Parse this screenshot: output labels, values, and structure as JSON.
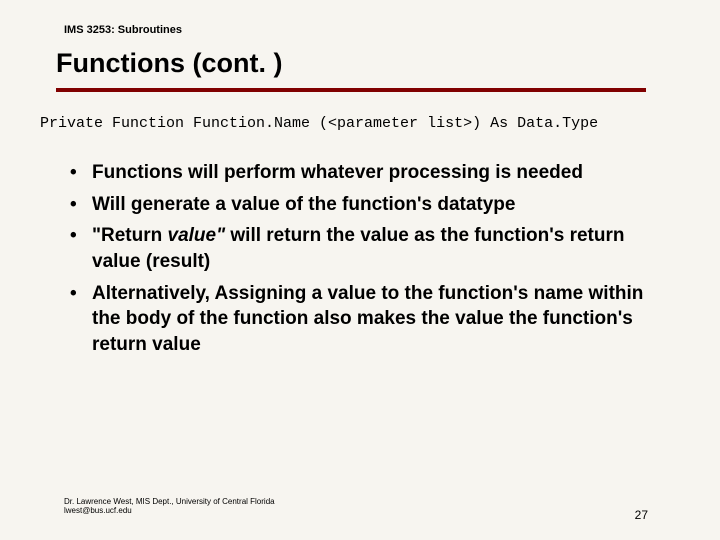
{
  "header": {
    "course": "IMS 3253: Subroutines"
  },
  "title": "Functions (cont. )",
  "code": "Private Function Function.Name (<parameter list>) As Data.Type",
  "bullets": [
    {
      "text": "Functions will perform whatever processing is needed"
    },
    {
      "text": "Will generate a value of the function's datatype"
    },
    {
      "prefix": "\"Return ",
      "em": "value\"",
      "suffix": " will return the value as the function's return value (result)"
    },
    {
      "text": "Alternatively, Assigning a value to the function's name within the body of the function also makes the value the function's return value"
    }
  ],
  "footer": {
    "line1": "Dr. Lawrence West, MIS Dept., University of Central Florida",
    "line2": "lwest@bus.ucf.edu"
  },
  "pagenum": "27"
}
